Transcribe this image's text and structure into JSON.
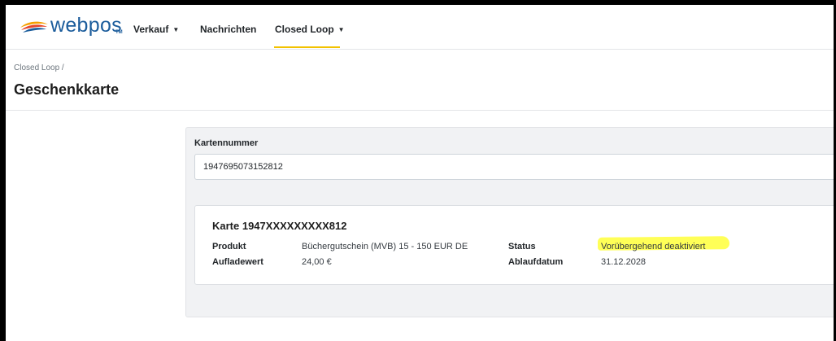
{
  "navbar": {
    "logo_text": "webpos",
    "logo_tm": "TM",
    "items": [
      {
        "label": "Verkauf",
        "dropdown": true
      },
      {
        "label": "Nachrichten",
        "dropdown": false
      },
      {
        "label": "Closed Loop",
        "dropdown": true,
        "active": true
      }
    ],
    "caret": "▼"
  },
  "header": {
    "breadcrumb": "Closed Loop /",
    "title": "Geschenkkarte"
  },
  "lookup": {
    "label": "Kartennummer",
    "value": "1947695073152812"
  },
  "card": {
    "title": "Karte 1947XXXXXXXXX812",
    "product_label": "Produkt",
    "product_value": "Büchergutschein (MVB) 15 - 150 EUR DE",
    "charge_label": "Aufladewert",
    "charge_value": "24,00 €",
    "status_label": "Status",
    "status_value": "Vorübergehend deaktiviert",
    "expiry_label": "Ablaufdatum",
    "expiry_value": "31.12.2028"
  },
  "colors": {
    "brand_blue": "#1c5d9c",
    "brand_orange": "#f5a000",
    "nav_active": "#f2c200",
    "highlight": "#ffff57"
  }
}
